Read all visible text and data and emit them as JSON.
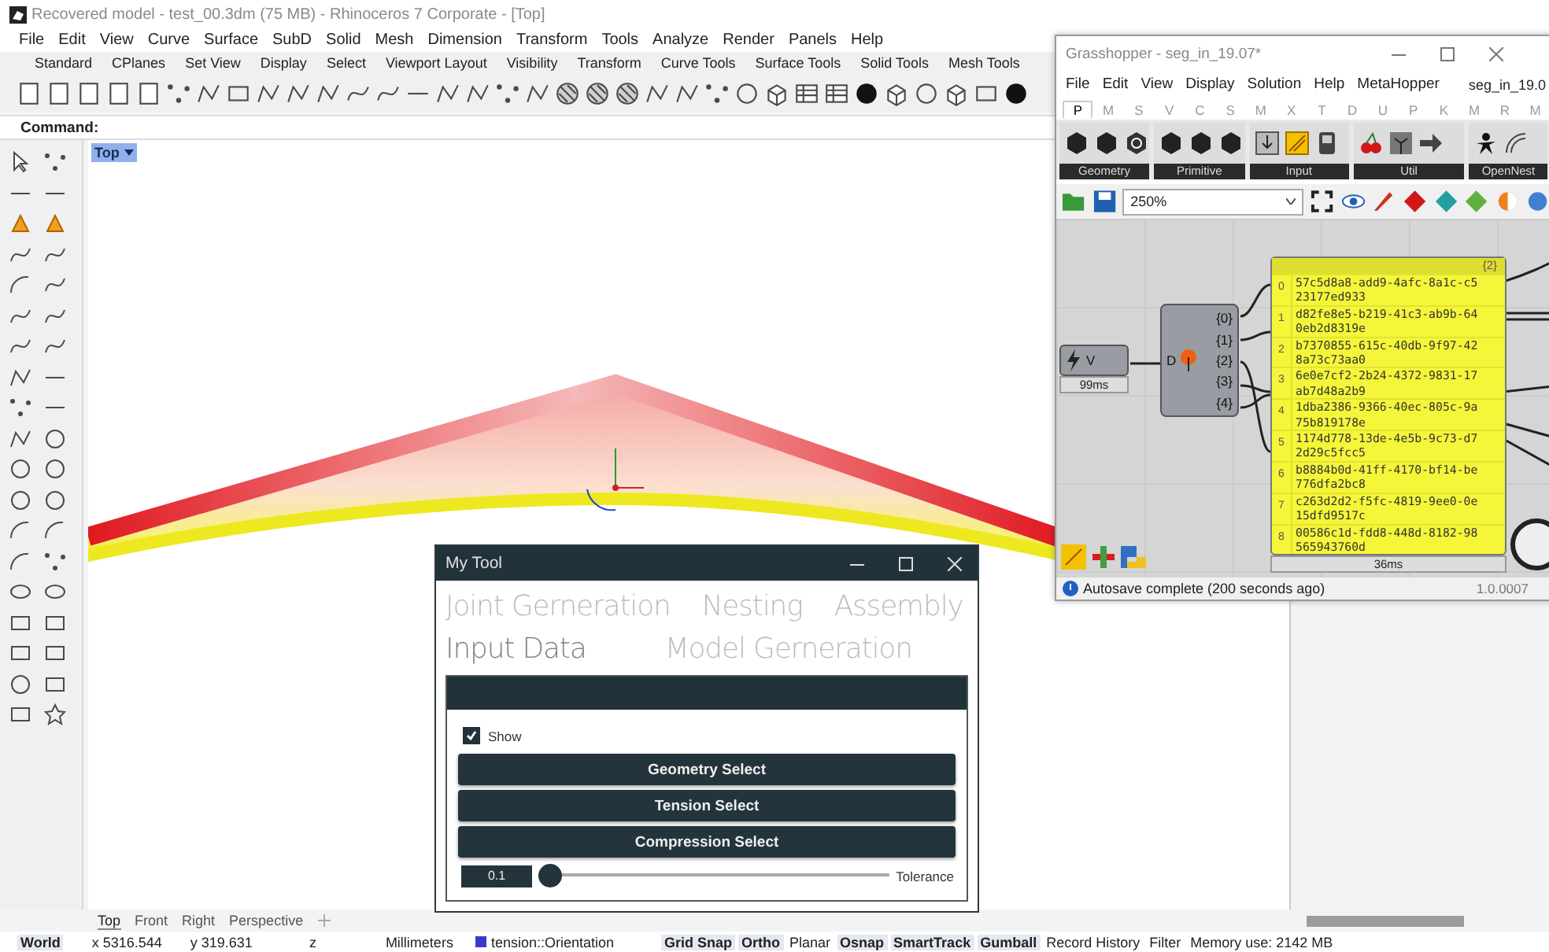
{
  "rhino": {
    "title": "Recovered model - test_00.3dm (75 MB) - Rhinoceros 7 Corporate - [Top]",
    "menu": [
      "File",
      "Edit",
      "View",
      "Curve",
      "Surface",
      "SubD",
      "Solid",
      "Mesh",
      "Dimension",
      "Transform",
      "Tools",
      "Analyze",
      "Render",
      "Panels",
      "Help"
    ],
    "toolbar_tabs": [
      "Standard",
      "CPlanes",
      "Set View",
      "Display",
      "Select",
      "Viewport Layout",
      "Visibility",
      "Transform",
      "Curve Tools",
      "Surface Tools",
      "Solid Tools",
      "Mesh Tools"
    ],
    "command_label": "Command:",
    "viewport_label": "Top",
    "view_tabs": [
      {
        "label": "Top",
        "selected": true
      },
      {
        "label": "Front",
        "selected": false
      },
      {
        "label": "Right",
        "selected": false
      },
      {
        "label": "Perspective",
        "selected": false
      }
    ],
    "status_bar": [
      {
        "text": "World",
        "on": true
      },
      {
        "text": "x 5316.544",
        "on": false
      },
      {
        "text": "y 319.631",
        "on": false
      },
      {
        "text": "z",
        "on": false
      },
      {
        "text": "Millimeters",
        "on": false
      },
      {
        "text": "tension::Orientation",
        "on": false,
        "color": "#3a3ad0"
      },
      {
        "text": "Grid Snap",
        "on": true
      },
      {
        "text": "Ortho",
        "on": true
      },
      {
        "text": "Planar",
        "on": false
      },
      {
        "text": "Osnap",
        "on": true
      },
      {
        "text": "SmartTrack",
        "on": true
      },
      {
        "text": "Gumball",
        "on": true
      },
      {
        "text": "Record History",
        "on": false
      },
      {
        "text": "Filter",
        "on": false
      },
      {
        "text": "Memory use: 2142 MB",
        "on": false
      }
    ]
  },
  "grasshopper": {
    "title": "Grasshopper - seg_in_19.07*",
    "menu": [
      "File",
      "Edit",
      "View",
      "Display",
      "Solution",
      "Help",
      "MetaHopper"
    ],
    "document_name": "seg_in_19.0",
    "tabs": [
      {
        "label": "P",
        "selected": true
      },
      {
        "label": "M",
        "selected": false
      },
      {
        "label": "S",
        "selected": false
      },
      {
        "label": "V",
        "selected": false
      },
      {
        "label": "C",
        "selected": false
      },
      {
        "label": "S",
        "selected": false
      },
      {
        "label": "M",
        "selected": false
      },
      {
        "label": "X",
        "selected": false
      },
      {
        "label": "T",
        "selected": false
      },
      {
        "label": "D",
        "selected": false
      },
      {
        "label": "U",
        "selected": false
      },
      {
        "label": "P",
        "selected": false
      },
      {
        "label": "K",
        "selected": false
      },
      {
        "label": "M",
        "selected": false
      },
      {
        "label": "R",
        "selected": false
      },
      {
        "label": "M",
        "selected": false
      }
    ],
    "groups": [
      "Geometry",
      "Primitive",
      "Input",
      "Util",
      "OpenNest"
    ],
    "zoom": "250%",
    "canvas": {
      "param": {
        "label": "V",
        "timing": "99ms"
      },
      "component": {
        "input": "D",
        "outputs": [
          "{0}",
          "{1}",
          "{2}",
          "{3}",
          "{4}"
        ]
      },
      "panel": {
        "header": "{2}",
        "timing": "36ms",
        "items": [
          {
            "index": "0",
            "text": "57c5d8a8-add9-4afc-8a1c-c523177ed933"
          },
          {
            "index": "1",
            "text": "d82fe8e5-b219-41c3-ab9b-640eb2d8319e"
          },
          {
            "index": "2",
            "text": "b7370855-615c-40db-9f97-428a73c73aa0"
          },
          {
            "index": "3",
            "text": "6e0e7cf2-2b24-4372-9831-17ab7d48a2b9"
          },
          {
            "index": "4",
            "text": "1dba2386-9366-40ec-805c-9a75b819178e"
          },
          {
            "index": "5",
            "text": "1174d778-13de-4e5b-9c73-d72d29c5fcc5"
          },
          {
            "index": "6",
            "text": "b8884b0d-41ff-4170-bf14-be776dfa2bc8"
          },
          {
            "index": "7",
            "text": "c263d2d2-f5fc-4819-9ee0-0e15dfd9517c"
          },
          {
            "index": "8",
            "text": "00586c1d-fdd8-448d-8182-98565943760d"
          }
        ]
      }
    },
    "status": "Autosave complete (200 seconds ago)",
    "version": "1.0.0007"
  },
  "my_tool": {
    "title": "My Tool",
    "tabs": [
      {
        "label": "Joint Gerneration",
        "selected": false
      },
      {
        "label": "Nesting",
        "selected": false
      },
      {
        "label": "Assembly",
        "selected": false
      },
      {
        "label": "Input Data",
        "selected": true
      },
      {
        "label": "Model Gerneration",
        "selected": false
      }
    ],
    "show": {
      "label": "Show",
      "checked": true
    },
    "buttons": [
      "Geometry Select",
      "Tension Select",
      "Compression Select"
    ],
    "slider": {
      "value": "0.1",
      "level": 0.0,
      "label": "Tolerance"
    }
  }
}
